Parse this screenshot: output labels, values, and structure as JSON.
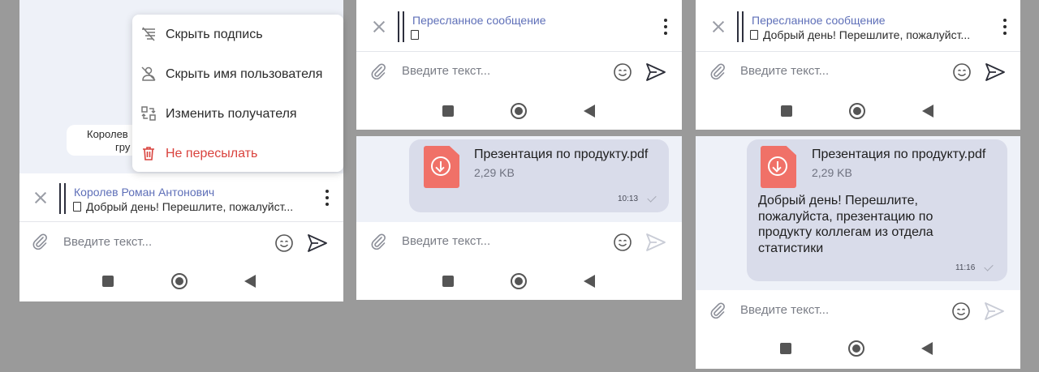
{
  "input": {
    "placeholder": "Введите текст..."
  },
  "panel1": {
    "background_bubble_line1": "Королев",
    "background_bubble_line2": "гру",
    "menu": [
      {
        "label": "Скрыть подпись",
        "icon": "hide-caption-icon",
        "danger": false
      },
      {
        "label": "Скрыть имя пользователя",
        "icon": "hide-user-icon",
        "danger": false
      },
      {
        "label": "Изменить получателя",
        "icon": "change-recipient-icon",
        "danger": false
      },
      {
        "label": "Не пересылать",
        "icon": "trash-icon",
        "danger": true
      }
    ],
    "forward_author": "Королев Роман Антонович",
    "forward_text": "Добрый день! Перешлите, пожалуйст..."
  },
  "panel2": {
    "forward_title": "Пересланное сообщение",
    "forward_text": "",
    "file_name": "Презентация по продукту.pdf",
    "file_size": "2,29 KB",
    "time": "10:13"
  },
  "panel3": {
    "forward_title": "Пересланное сообщение",
    "forward_text": "Добрый день! Перешлите, пожалуйст...",
    "file_name": "Презентация по продукту.pdf",
    "file_size": "2,29 KB",
    "message": "Добрый день! Перешлите, пожалуйста, презентацию по продукту коллегам из отдела статистики",
    "time": "11:16"
  },
  "colors": {
    "accent": "#5e6fb8",
    "danger": "#d9423d",
    "bubble": "#d9dcea",
    "pdf": "#f07168"
  }
}
